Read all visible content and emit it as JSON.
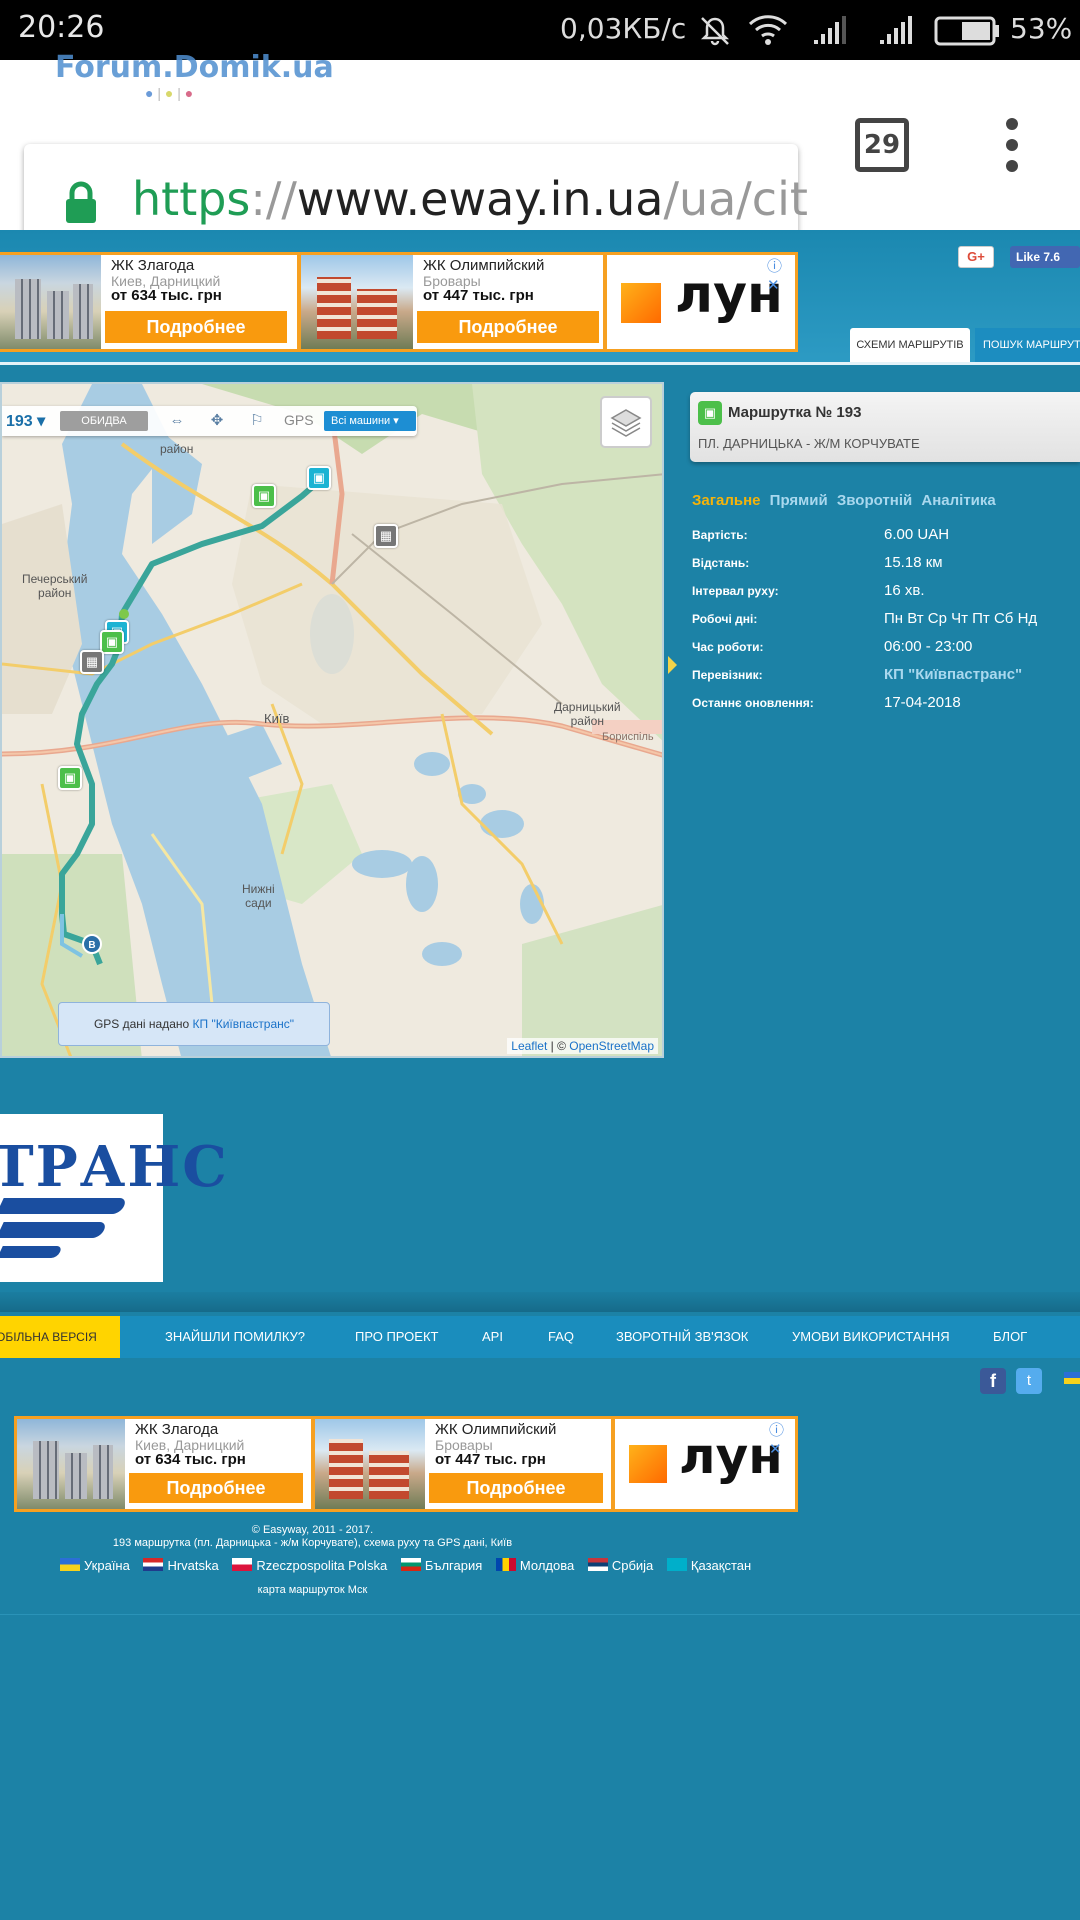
{
  "status_bar": {
    "time": "20:26",
    "speed": "0,03КБ/с",
    "battery": "53%"
  },
  "browser": {
    "watermark": "Forum.Domik.ua",
    "url_scheme": "https",
    "url_sep": "://",
    "url_host": "www.eway.in.ua",
    "url_path": "/ua/cit",
    "tabs_count": "29"
  },
  "ads": [
    {
      "title": "ЖК Злагода",
      "sub": "Киев, Дарницкий",
      "price": "от 634 тыс. грн",
      "button": "Подробнее"
    },
    {
      "title": "ЖК Олимпийский",
      "sub": "Бровары",
      "price": "от 447 тыс. грн",
      "button": "Подробнее"
    },
    {
      "brand": "лун"
    }
  ],
  "social": {
    "gplus": "G+",
    "fb_like": "Like 7.6"
  },
  "tabs": {
    "schemes": "СХЕМИ МАРШРУТІВ",
    "search": "ПОШУК МАРШРУТ"
  },
  "map": {
    "toolbar": {
      "route": "193",
      "both": "ОБИДВА",
      "gps": "GPS",
      "all_vehicles": "Всі машини"
    },
    "labels": {
      "rayon_top": "район",
      "pechersk": "Печерський\nрайон",
      "kyiv": "Київ",
      "darnytskyi": "Дарницький\nрайон",
      "boryspil": "Бориспіль",
      "nyzhni_sady": "Нижні\nсади"
    },
    "gps_note_prefix": "GPS дані надано ",
    "gps_note_link": "КП \"Київпастранс\"",
    "attribution_leaflet": "Leaflet",
    "attribution_sep": " | © ",
    "attribution_osm": "OpenStreetMap"
  },
  "route_info": {
    "title": "Маршрутка № 193",
    "subtitle": "ПЛ. ДАРНИЦЬКА - Ж/М КОРЧУВАТЕ",
    "tabs": [
      "Загальне",
      "Прямий",
      "Зворотній",
      "Аналітика"
    ],
    "rows": [
      {
        "label": "Вартість:",
        "value": "6.00 UAH"
      },
      {
        "label": "Відстань:",
        "value": "15.18 км"
      },
      {
        "label": "Інтервал руху:",
        "value": "16 хв."
      },
      {
        "label": "Робочі дні:",
        "value": "Пн Вт Ср Чт Пт Сб Нд"
      },
      {
        "label": "Час роботи:",
        "value": "06:00 - 23:00"
      },
      {
        "label": "Перевізник:",
        "value": "КП \"Київпастранс\""
      },
      {
        "label": "Останнє оновлення:",
        "value": "17-04-2018"
      }
    ]
  },
  "carrier_logo": {
    "text": "ТРАНС"
  },
  "nav": {
    "mobile": "МОБІЛЬНА ВЕРСІЯ",
    "items": [
      "ЗНАЙШЛИ ПОМИЛКУ?",
      "ПРО ПРОЕКТ",
      "API",
      "FAQ",
      "ЗВОРОТНІЙ ЗВ'ЯЗОК",
      "УМОВИ ВИКОРИСТАННЯ",
      "БЛОГ"
    ]
  },
  "footer": {
    "copyright": "© Easyway, 2011 - 2017.",
    "description": "193 маршрутка (пл. Дарницька - ж/м Корчувате), схема руху та GPS дані, Київ",
    "languages": [
      "Україна",
      "Hrvatska",
      "Rzeczpospolita Polska",
      "България",
      "Молдова",
      "Србија",
      "Қазақстан"
    ],
    "map_link": "карта маршруток Мск"
  },
  "colors": {
    "accent": "#1c82a6",
    "orange": "#f99a0e",
    "route": "#3aa59a",
    "tab_active": "#f5b30a"
  }
}
